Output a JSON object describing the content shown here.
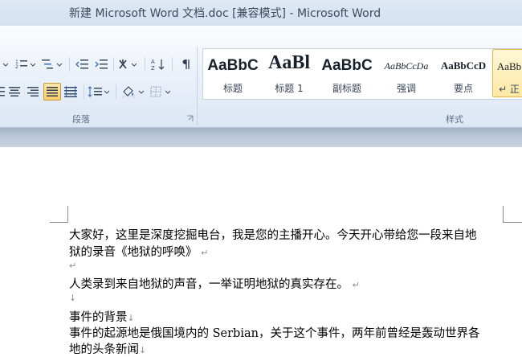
{
  "window": {
    "title": "新建 Microsoft Word 文档.doc [兼容模式]  -  Microsoft Word"
  },
  "ribbon": {
    "groups": {
      "paragraph": "段落",
      "styles": "样式"
    },
    "styles": [
      {
        "sample": "AaBbC",
        "name": "标题",
        "selected": false
      },
      {
        "sample": "AaBl",
        "name": "标题 1",
        "selected": false
      },
      {
        "sample": "AaBbC",
        "name": "副标题",
        "selected": false
      },
      {
        "sample": "AaBbCcDa",
        "name": "强调",
        "selected": false
      },
      {
        "sample": "AaBbCcD",
        "name": "要点",
        "selected": false
      },
      {
        "sample": "AaBb",
        "name": "↵ 正",
        "selected": true
      }
    ]
  },
  "document": {
    "lines": [
      {
        "text": "大家好，这里是深度挖掘电台，我是您的主播开心。今天开心带给您一段来自地"
      },
      {
        "text": "狱的录音《地狱的呼唤》",
        "mark": "↵"
      },
      {
        "text": "",
        "mark": "↵"
      },
      {
        "text": "人类录到来自地狱的声音，一举证明地狱的真实存在。",
        "mark": "↵"
      },
      {
        "text": "",
        "mark": "↓"
      },
      {
        "text": "事件的背景",
        "mark": "↓"
      },
      {
        "text_before": "事件的起源地是俄国境内的 ",
        "latin": "Serbian",
        "text_after": "，关于这个事件，两年前曾经是轰动世界各"
      },
      {
        "text": "地的头条新闻",
        "mark": "↓"
      }
    ]
  }
}
